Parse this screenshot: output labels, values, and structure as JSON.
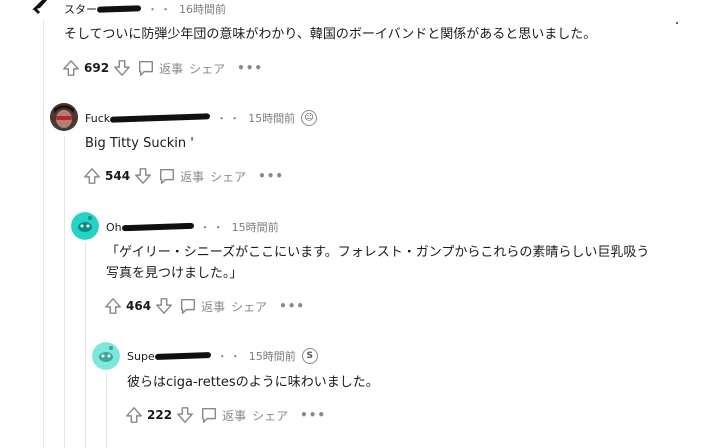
{
  "comments": [
    {
      "username": "スター",
      "time": "16時間前",
      "text": "そしてついに防弾少年団の意味がわかり、韓国のボーイバンドと関係があると思いました。",
      "text_line2": "",
      "votes": "692",
      "reply_label": "返事",
      "share_label": "シェア"
    },
    {
      "username": "Fuck",
      "time": "15時間前",
      "text": "Big Titty Suckin '",
      "text_line2": "",
      "votes": "544",
      "reply_label": "返事",
      "share_label": "シェア"
    },
    {
      "username": "Oh",
      "time": "15時間前",
      "text": "「ゲイリー・シニーズがここにいます。フォレスト・ガンプからこれらの素晴らしい巨乳吸う",
      "text_line2": "写真を見つけました。」",
      "votes": "464",
      "reply_label": "返事",
      "share_label": "シェア"
    },
    {
      "username": "Supe",
      "time": "15時間前",
      "text": "彼らはciga-rettesのように味わいました。",
      "text_line2": "",
      "votes": "222",
      "reply_label": "返事",
      "share_label": "シェア"
    }
  ],
  "dots_separator": "・",
  "more_label": "•••",
  "badges": [
    "☺",
    "S"
  ],
  "colors": {
    "avatar_teal": "#24d3c4",
    "avatar_teal_light": "#7fe6dc",
    "meta_grey": "#7c7c7c",
    "text": "#1a1a1b"
  }
}
